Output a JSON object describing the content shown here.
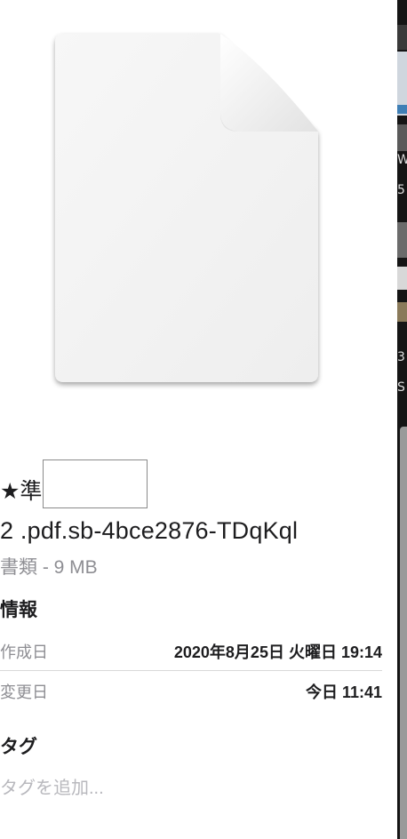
{
  "file": {
    "name_prefix": "★準",
    "name_rest": "2 .pdf.sb-4bce2876-TDqKql",
    "kind_size": "書類 - 9 MB"
  },
  "info": {
    "heading": "情報",
    "created_label": "作成日",
    "created_value": "2020年8月25日 火曜日 19:14",
    "modified_label": "変更日",
    "modified_value": "今日 11:41"
  },
  "tags": {
    "heading": "タグ",
    "placeholder": "タグを追加..."
  },
  "side_strip": {
    "glyphs": [
      "W",
      "5",
      "3",
      "S"
    ]
  },
  "colors": {
    "secondary_text": "#8e8e93",
    "primary_text": "#1d1d1f",
    "placeholder_text": "#b8b8bd"
  },
  "icons": {
    "preview": "generic-document-icon"
  }
}
